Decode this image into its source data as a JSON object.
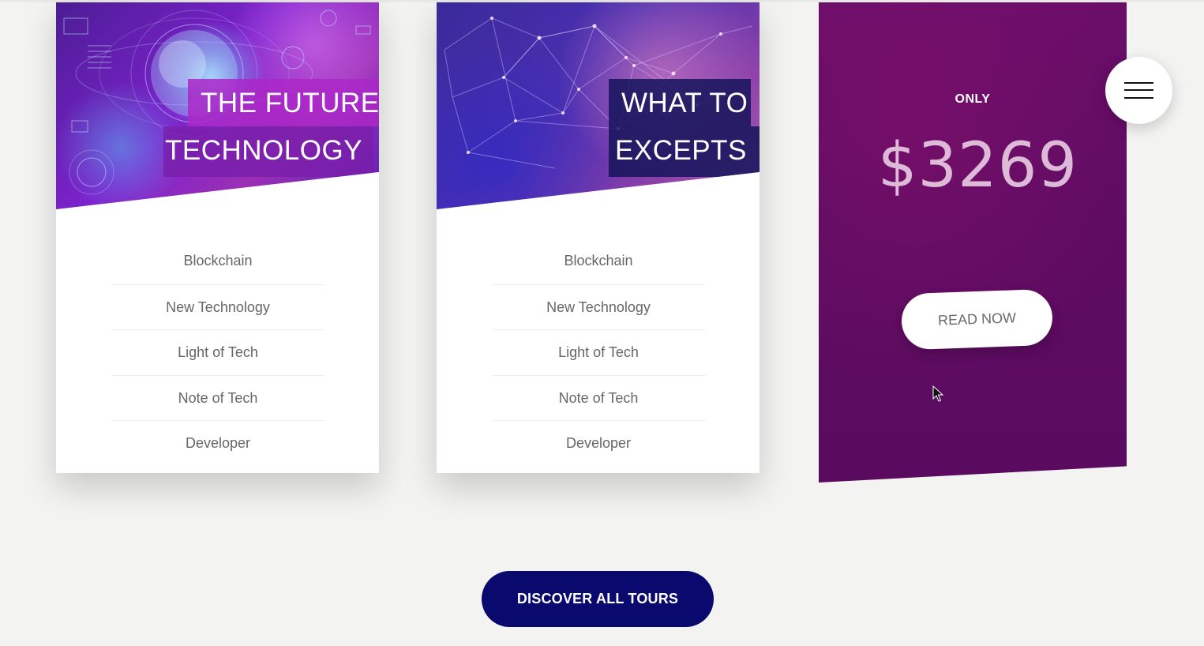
{
  "cards": [
    {
      "title_line1": "THE FUTURE",
      "title_line2": "TECHNOLOGY",
      "features": [
        "Blockchain",
        "New Technology",
        "Light of Tech",
        "Note of Tech",
        "Developer"
      ]
    },
    {
      "title_line1": "WHAT TO",
      "title_line2": "EXCEPTS",
      "features": [
        "Blockchain",
        "New Technology",
        "Light of Tech",
        "Note of Tech",
        "Developer"
      ]
    }
  ],
  "price_card": {
    "label": "ONLY",
    "price": "$3269",
    "button_label": "READ NOW"
  },
  "menu": {
    "icon": "hamburger-menu-icon"
  },
  "discover_button_label": "DISCOVER ALL TOURS",
  "colors": {
    "background": "#f3f4f2",
    "price_card": "#5e0c62",
    "discover_button": "#0a0a6e",
    "feature_text": "#666666"
  }
}
